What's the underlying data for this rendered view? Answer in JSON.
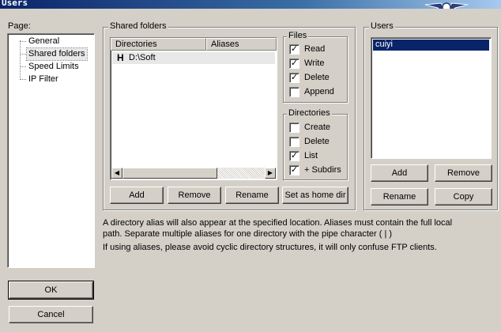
{
  "window": {
    "title": "Users"
  },
  "page_panel": {
    "label": "Page:",
    "items": [
      {
        "label": "General"
      },
      {
        "label": "Shared folders",
        "selected": true
      },
      {
        "label": "Speed Limits"
      },
      {
        "label": "IP Filter"
      }
    ]
  },
  "shared_folders": {
    "title": "Shared folders",
    "columns": [
      "Directories",
      "Aliases"
    ],
    "rows": [
      {
        "marker": "H",
        "directory": "D:\\Soft",
        "alias": ""
      }
    ],
    "buttons": {
      "add": "Add",
      "remove": "Remove",
      "rename": "Rename",
      "set_home": "Set as home dir"
    }
  },
  "files_group": {
    "title": "Files",
    "options": [
      {
        "label": "Read",
        "checked": true
      },
      {
        "label": "Write",
        "checked": true
      },
      {
        "label": "Delete",
        "checked": true
      },
      {
        "label": "Append",
        "checked": false
      }
    ]
  },
  "dirs_group": {
    "title": "Directories",
    "options": [
      {
        "label": "Create",
        "checked": false
      },
      {
        "label": "Delete",
        "checked": false
      },
      {
        "label": "List",
        "checked": true
      },
      {
        "label": "+ Subdirs",
        "checked": true
      }
    ]
  },
  "users_panel": {
    "title": "Users",
    "list": [
      {
        "name": "cuiyi",
        "selected": true
      }
    ],
    "buttons": {
      "add": "Add",
      "remove": "Remove",
      "rename": "Rename",
      "copy": "Copy"
    }
  },
  "notes": {
    "line1": "A directory alias will also appear at the specified location. Aliases must contain the full local",
    "line2": "path. Separate multiple aliases for one directory with the pipe character ( | )",
    "line3": "If using aliases, please avoid cyclic directory structures, it will only confuse FTP clients."
  },
  "footer": {
    "ok": "OK",
    "cancel": "Cancel"
  },
  "colors": {
    "selection": "#0a246a",
    "face": "#d4d0c8",
    "title_start": "#0a246a"
  },
  "icons": {
    "checkmark": "check-icon",
    "scroll_left": "arrow-left-icon",
    "scroll_right": "arrow-right-icon"
  }
}
